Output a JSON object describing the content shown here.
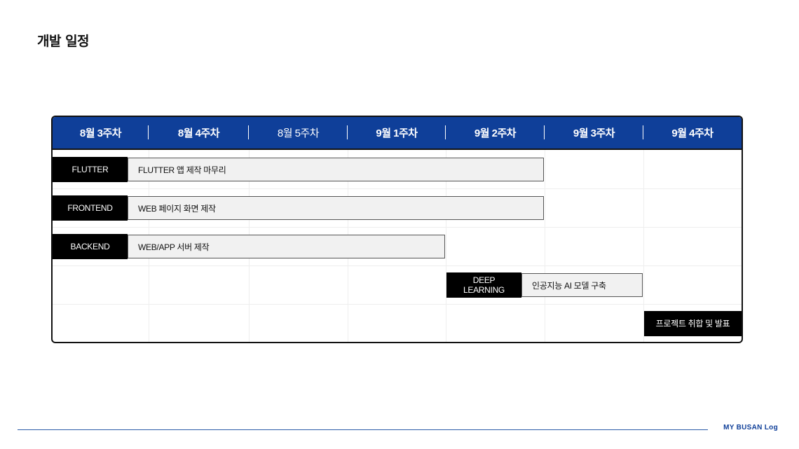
{
  "page": {
    "title": "개발 일정"
  },
  "schedule": {
    "weeks": [
      {
        "label": "8월 3주차",
        "style": "bold"
      },
      {
        "label": "8월 4주차",
        "style": "bold"
      },
      {
        "label": "8월 5주차",
        "style": "light"
      },
      {
        "label": "9월 1주차",
        "style": "bold"
      },
      {
        "label": "9월 2주차",
        "style": "bold"
      },
      {
        "label": "9월 3주차",
        "style": "bold"
      },
      {
        "label": "9월 4주차",
        "style": "bold"
      }
    ],
    "tasks": [
      {
        "label": "FLUTTER",
        "bar": "FLUTTER 앱 제작 마무리"
      },
      {
        "label": "FRONTEND",
        "bar": "WEB 페이지 화면 제작"
      },
      {
        "label": "BACKEND",
        "bar": "WEB/APP 서버 제작"
      },
      {
        "label": "DEEP\nLEARNING",
        "bar": "인공지능 AI 모델 구축"
      },
      {
        "label": "프로젝트 취합 및 발표",
        "bar": ""
      }
    ]
  },
  "footer": {
    "brand": "MY BUSAN Log"
  },
  "colors": {
    "header_bg": "#0f3f99",
    "label_bg": "#000000",
    "bar_bg": "#f1f1f1",
    "accent": "#2b5aa8"
  }
}
